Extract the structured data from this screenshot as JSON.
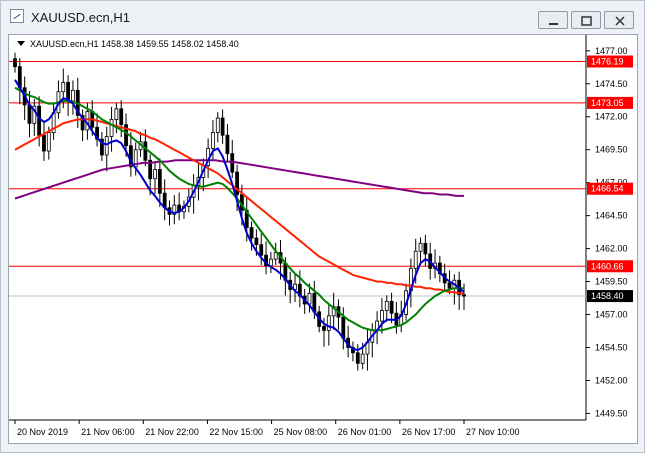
{
  "window": {
    "title": "XAUUSD.ecn,H1",
    "buttons": {
      "minimize": "minimize-icon",
      "restore": "restore-icon",
      "close": "close-icon"
    }
  },
  "chart_info": {
    "symbol": "XAUUSD.ecn,H1",
    "open": "1458.38",
    "high": "1459.55",
    "low": "1458.02",
    "close": "1458.40"
  },
  "colors": {
    "price_line": "#ff0000",
    "bid_line": "#c0c0c0",
    "ma_fast": "#0000cc",
    "ma_mid": "#008000",
    "ma_slow": "#ff2200",
    "ma_long": "#800080",
    "candle": "#000000"
  },
  "chart_data": {
    "type": "candlestick",
    "title": "",
    "ylim": [
      1449.0,
      1478.2
    ],
    "price_ticks": [
      "1477.00",
      "1474.50",
      "1472.00",
      "1469.50",
      "1467.00",
      "1464.50",
      "1462.00",
      "1459.50",
      "1457.00",
      "1454.50",
      "1452.00",
      "1449.50"
    ],
    "time_ticks": [
      "20 Nov 2019",
      "21 Nov 06:00",
      "21 Nov 22:00",
      "22 Nov 15:00",
      "25 Nov 08:00",
      "26 Nov 01:00",
      "26 Nov 17:00",
      "27 Nov 10:00"
    ],
    "horizontal_lines": [
      {
        "label": "1476.19",
        "value": 1476.19
      },
      {
        "label": "1473.05",
        "value": 1473.05
      },
      {
        "label": "1466.54",
        "value": 1466.54
      },
      {
        "label": "1460.66",
        "value": 1460.66
      }
    ],
    "bid_line": {
      "label": "1458.40",
      "value": 1458.4
    },
    "closes": [
      1475.8,
      1474.2,
      1472.9,
      1471.5,
      1472.8,
      1470.6,
      1469.4,
      1470.8,
      1472.3,
      1473.9,
      1474.6,
      1473.2,
      1474.0,
      1472.1,
      1471.0,
      1472.4,
      1471.2,
      1470.3,
      1469.1,
      1470.5,
      1471.8,
      1472.6,
      1471.4,
      1469.8,
      1468.2,
      1469.5,
      1470.1,
      1468.7,
      1467.3,
      1468.0,
      1466.2,
      1465.1,
      1464.6,
      1465.3,
      1464.8,
      1465.2,
      1465.9,
      1466.8,
      1467.4,
      1468.3,
      1469.6,
      1470.8,
      1471.9,
      1470.6,
      1469.2,
      1467.8,
      1466.1,
      1464.9,
      1463.6,
      1462.8,
      1462.3,
      1461.5,
      1460.7,
      1461.2,
      1461.7,
      1460.9,
      1459.6,
      1458.9,
      1459.3,
      1458.4,
      1457.8,
      1458.6,
      1457.2,
      1456.1,
      1455.8,
      1456.9,
      1457.6,
      1456.8,
      1455.2,
      1454.5,
      1454.1,
      1453.3,
      1454.0,
      1454.9,
      1455.8,
      1456.5,
      1457.3,
      1458.0,
      1457.1,
      1456.2,
      1457.0,
      1458.8,
      1460.5,
      1461.8,
      1462.4,
      1461.6,
      1460.5,
      1460.9,
      1460.1,
      1459.4,
      1459.0,
      1459.6,
      1458.5,
      1458.4
    ],
    "ma_fast": [
      1474.8,
      1474.2,
      1473.6,
      1472.9,
      1472.5,
      1471.9,
      1471.6,
      1471.8,
      1472.3,
      1473.0,
      1473.4,
      1473.3,
      1473.0,
      1472.4,
      1471.9,
      1471.5,
      1470.9,
      1470.4,
      1470.0,
      1469.9,
      1470.1,
      1470.2,
      1470.0,
      1469.4,
      1468.6,
      1468.1,
      1467.6,
      1467.0,
      1466.4,
      1466.0,
      1465.5,
      1465.1,
      1464.8,
      1464.7,
      1464.8,
      1465.1,
      1465.6,
      1466.3,
      1467.1,
      1467.9,
      1468.7,
      1469.4,
      1469.6,
      1469.0,
      1468.0,
      1466.9,
      1465.6,
      1464.3,
      1463.2,
      1462.4,
      1461.8,
      1461.3,
      1460.9,
      1460.6,
      1460.4,
      1460.1,
      1459.7,
      1459.2,
      1458.8,
      1458.5,
      1458.1,
      1457.7,
      1457.2,
      1456.7,
      1456.3,
      1456.1,
      1456.0,
      1455.7,
      1455.2,
      1454.7,
      1454.4,
      1454.3,
      1454.5,
      1454.9,
      1455.4,
      1455.8,
      1456.3,
      1456.6,
      1456.6,
      1456.6,
      1456.9,
      1457.8,
      1458.9,
      1460.0,
      1460.9,
      1461.2,
      1461.0,
      1460.6,
      1460.2,
      1459.8,
      1459.5,
      1459.3,
      1459.0,
      1458.7
    ],
    "ma_mid": [
      1474.2,
      1474.0,
      1473.8,
      1473.6,
      1473.5,
      1473.3,
      1473.1,
      1473.0,
      1473.0,
      1473.1,
      1473.2,
      1473.2,
      1473.1,
      1473.0,
      1472.8,
      1472.6,
      1472.4,
      1472.1,
      1471.8,
      1471.6,
      1471.4,
      1471.2,
      1471.0,
      1470.8,
      1470.5,
      1470.2,
      1469.9,
      1469.6,
      1469.3,
      1469.0,
      1468.7,
      1468.3,
      1467.9,
      1467.6,
      1467.3,
      1467.1,
      1466.9,
      1466.8,
      1466.7,
      1466.7,
      1466.8,
      1466.9,
      1467.0,
      1466.9,
      1466.6,
      1466.2,
      1465.8,
      1465.3,
      1464.8,
      1464.3,
      1463.8,
      1463.3,
      1462.8,
      1462.3,
      1461.8,
      1461.4,
      1460.9,
      1460.5,
      1460.1,
      1459.8,
      1459.4,
      1459.1,
      1458.8,
      1458.5,
      1458.1,
      1457.8,
      1457.5,
      1457.2,
      1456.9,
      1456.6,
      1456.4,
      1456.2,
      1456.0,
      1455.9,
      1455.8,
      1455.8,
      1455.8,
      1455.9,
      1456.0,
      1456.1,
      1456.2,
      1456.4,
      1456.7,
      1457.0,
      1457.4,
      1457.8,
      1458.1,
      1458.4,
      1458.6,
      1458.8,
      1458.9,
      1459.0,
      1459.0,
      1459.0
    ],
    "ma_slow": [
      1469.5,
      1469.7,
      1469.9,
      1470.1,
      1470.3,
      1470.5,
      1470.7,
      1470.9,
      1471.1,
      1471.3,
      1471.5,
      1471.6,
      1471.7,
      1471.8,
      1471.8,
      1471.8,
      1471.8,
      1471.7,
      1471.6,
      1471.5,
      1471.4,
      1471.3,
      1471.2,
      1471.1,
      1471.0,
      1470.9,
      1470.7,
      1470.6,
      1470.4,
      1470.3,
      1470.1,
      1469.9,
      1469.7,
      1469.5,
      1469.3,
      1469.1,
      1468.9,
      1468.7,
      1468.5,
      1468.3,
      1468.1,
      1467.9,
      1467.7,
      1467.4,
      1467.1,
      1466.8,
      1466.5,
      1466.2,
      1465.9,
      1465.6,
      1465.3,
      1465.0,
      1464.7,
      1464.4,
      1464.1,
      1463.8,
      1463.5,
      1463.2,
      1462.9,
      1462.6,
      1462.3,
      1462.0,
      1461.7,
      1461.4,
      1461.2,
      1461.0,
      1460.8,
      1460.6,
      1460.4,
      1460.2,
      1460.0,
      1459.9,
      1459.8,
      1459.7,
      1459.6,
      1459.5,
      1459.5,
      1459.4,
      1459.4,
      1459.3,
      1459.3,
      1459.2,
      1459.2,
      1459.1,
      1459.1,
      1459.0,
      1459.0,
      1458.9,
      1458.9,
      1458.8,
      1458.7,
      1458.7,
      1458.6,
      1458.6
    ],
    "ma_long": [
      1465.8,
      1466.0,
      1466.2,
      1466.4,
      1466.6,
      1466.8,
      1467.0,
      1467.2,
      1467.4,
      1467.6,
      1467.8,
      1468.0,
      1468.1,
      1468.2,
      1468.3,
      1468.4,
      1468.5,
      1468.5,
      1468.6,
      1468.6,
      1468.7,
      1468.7,
      1468.7,
      1468.7,
      1468.7,
      1468.7,
      1468.6,
      1468.6,
      1468.5,
      1468.4,
      1468.3,
      1468.2,
      1468.1,
      1468.0,
      1467.9,
      1467.8,
      1467.7,
      1467.6,
      1467.5,
      1467.4,
      1467.3,
      1467.2,
      1467.1,
      1467.0,
      1466.9,
      1466.8,
      1466.7,
      1466.6,
      1466.5,
      1466.4,
      1466.3,
      1466.2,
      1466.2,
      1466.1,
      1466.1,
      1466.0,
      1466.0
    ]
  }
}
